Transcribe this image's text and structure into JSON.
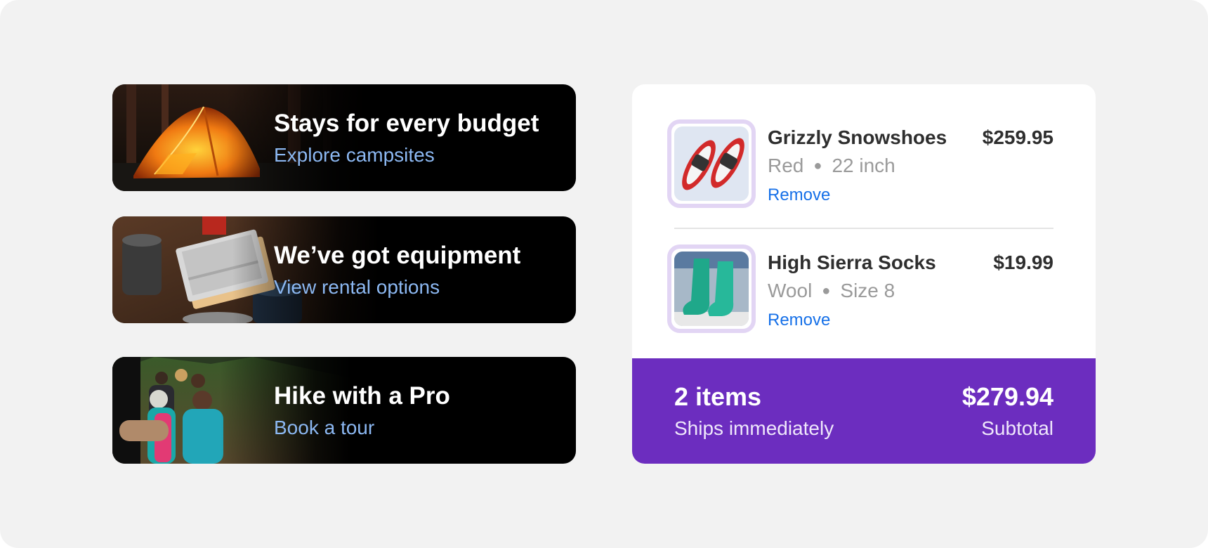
{
  "promos": [
    {
      "title": "Stays for every budget",
      "link": "Explore campsites"
    },
    {
      "title": "We’ve got equipment",
      "link": "View rental options"
    },
    {
      "title": "Hike with a Pro",
      "link": "Book a tour"
    }
  ],
  "cart": {
    "items": [
      {
        "name": "Grizzly Snowshoes",
        "price": "$259.95",
        "option1": "Red",
        "option2": "22 inch",
        "remove": "Remove"
      },
      {
        "name": "High Sierra Socks",
        "price": "$19.99",
        "option1": "Wool",
        "option2": "Size 8",
        "remove": "Remove"
      }
    ],
    "summary": {
      "count": "2 items",
      "shipping": "Ships immediately",
      "total": "$279.94",
      "total_label": "Subtotal"
    }
  },
  "colors": {
    "accent": "#6c2dbf",
    "link": "#1670e8",
    "promo_link": "#8cb8f2",
    "thumb_border": "#e2d5f4"
  }
}
